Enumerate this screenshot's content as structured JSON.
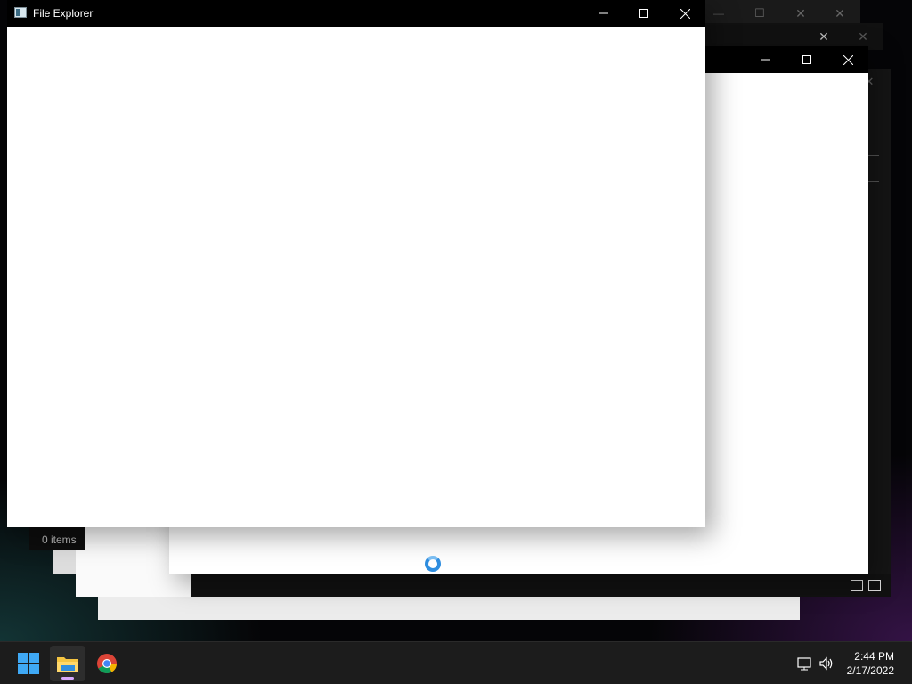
{
  "front_window": {
    "title": "File Explorer",
    "minimize_label": "—",
    "maximize_label": "☐",
    "close_label": "✕"
  },
  "middle_window": {
    "minimize_label": "—",
    "maximize_label": "☐",
    "close_label": "✕"
  },
  "back_windows": {
    "minimize_label": "—",
    "maximize_label": "☐",
    "close_label": "✕"
  },
  "status_bar": {
    "item_count": "0 items"
  },
  "taskbar": {
    "apps": [
      "start",
      "file-explorer",
      "chrome"
    ],
    "clock_time": "2:44 PM",
    "clock_date": "2/17/2022"
  },
  "colors": {
    "accent": "#2f8ee0",
    "taskbar": "#1c1c1c",
    "titlebar": "#000000"
  }
}
